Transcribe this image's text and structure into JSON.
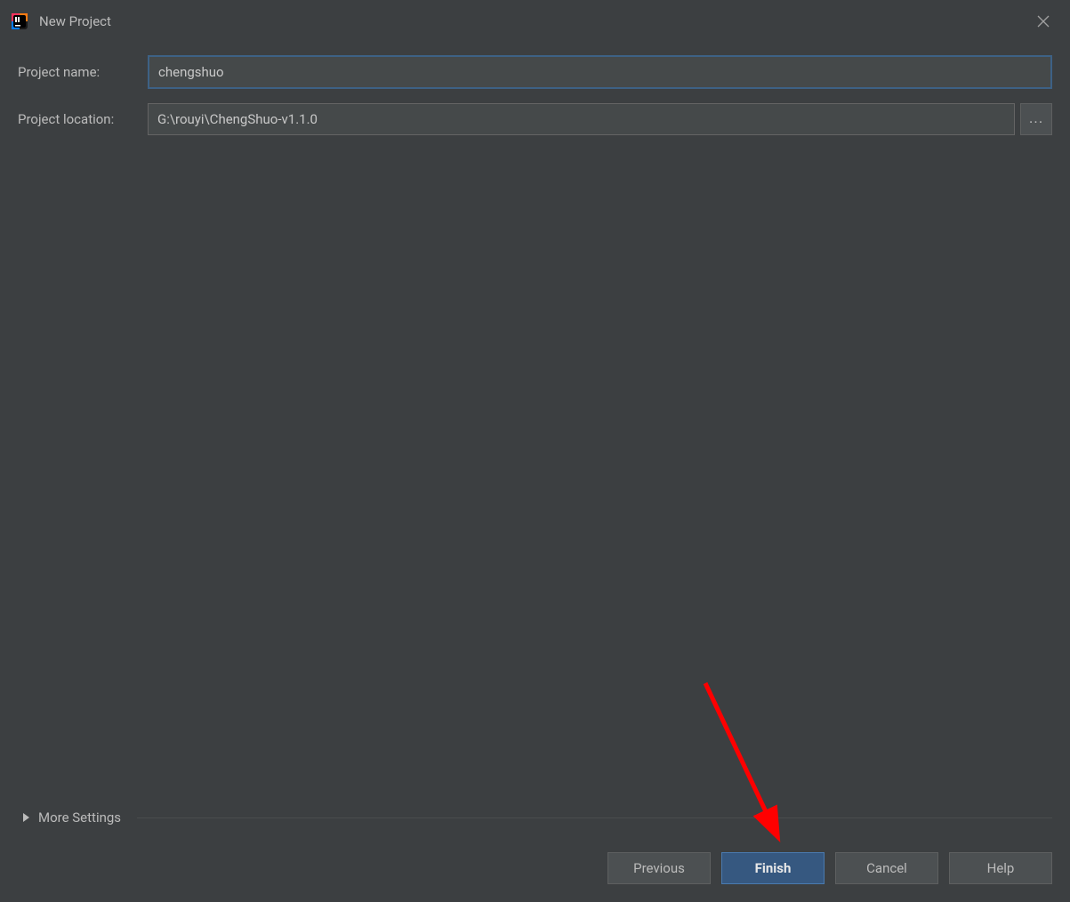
{
  "window": {
    "title": "New Project"
  },
  "form": {
    "name_label": "Project name:",
    "name_value": "chengshuo",
    "location_label": "Project location:",
    "location_value": "G:\\rouyi\\ChengShuo-v1.1.0",
    "browse_label": "..."
  },
  "more_settings": {
    "label": "More Settings"
  },
  "buttons": {
    "previous": "Previous",
    "finish": "Finish",
    "cancel": "Cancel",
    "help": "Help"
  }
}
